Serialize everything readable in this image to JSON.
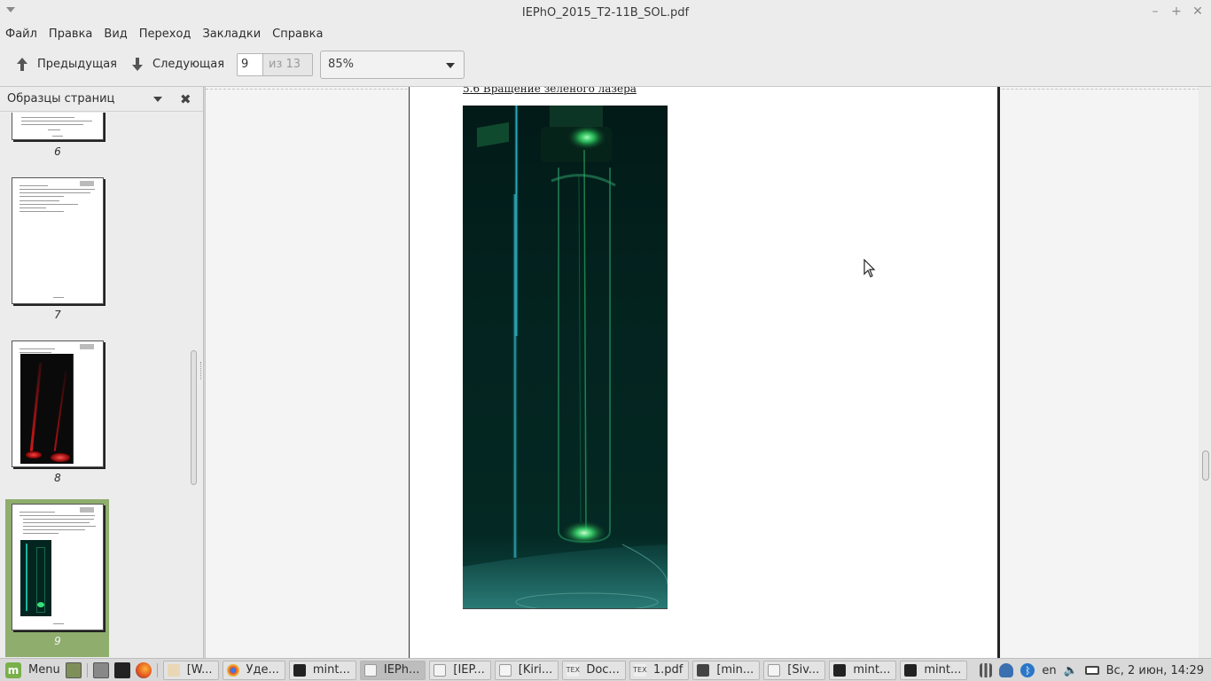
{
  "window": {
    "title": "IEPhO_2015_T2-11B_SOL.pdf",
    "controls": {
      "minimize": "–",
      "maximize": "+",
      "close": "✕"
    }
  },
  "menubar": {
    "items": [
      "Файл",
      "Правка",
      "Вид",
      "Переход",
      "Закладки",
      "Справка"
    ]
  },
  "toolbar": {
    "prev_label": "Предыдущая",
    "next_label": "Следующая",
    "page_value": "9",
    "page_total": "из 13",
    "zoom_value": "85%"
  },
  "sidebar": {
    "title": "Образцы страниц",
    "close_glyph": "✖",
    "thumbnails": [
      {
        "label": "6"
      },
      {
        "label": "7"
      },
      {
        "label": "8"
      },
      {
        "label": "9",
        "selected": true
      }
    ]
  },
  "document": {
    "caption": "5.6 Вращение зеленого лазера"
  },
  "taskbar": {
    "menu_label": "Menu",
    "tasks": [
      {
        "label": "[W...",
        "icon": "file-icon"
      },
      {
        "label": "Уде...",
        "icon": "chrome-icon"
      },
      {
        "label": "mint...",
        "icon": "terminal-icon"
      },
      {
        "label": "IEPh...",
        "icon": "pdf-icon",
        "active": true
      },
      {
        "label": "[IEP...",
        "icon": "file-icon"
      },
      {
        "label": "[Kiri...",
        "icon": "file-icon"
      },
      {
        "label": "Doc...",
        "icon": "tex-icon"
      },
      {
        "label": "1.pdf",
        "icon": "tex-icon"
      },
      {
        "label": "[min...",
        "icon": "terminal-icon"
      },
      {
        "label": "[Siv...",
        "icon": "file-icon"
      },
      {
        "label": "mint...",
        "icon": "terminal-icon"
      },
      {
        "label": "mint...",
        "icon": "terminal-icon"
      }
    ],
    "tray": {
      "language": "en",
      "clock": "Вс, 2 июн, 14:29"
    }
  },
  "colors": {
    "selection": "#8fad6d",
    "laser_green": "#37e07a",
    "mint_accent": "#79b04a"
  }
}
